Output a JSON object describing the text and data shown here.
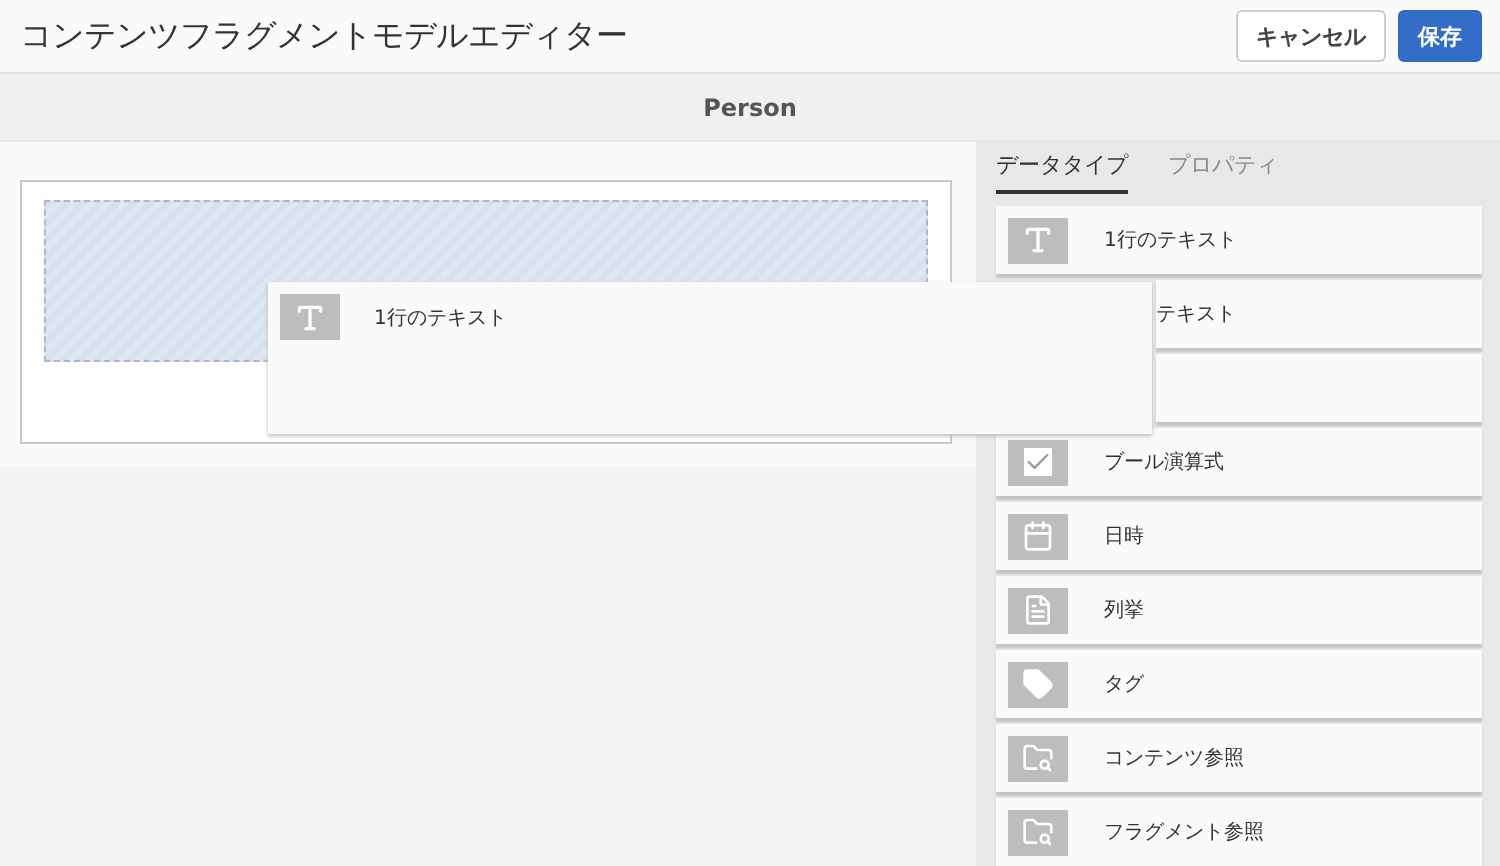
{
  "header": {
    "title": "コンテンツフラグメントモデルエディター",
    "buttons": [
      {
        "label": "キャンセル",
        "kind": "secondary"
      },
      {
        "label": "保存",
        "kind": "primary"
      }
    ]
  },
  "model_title": "Person",
  "dragged_item": {
    "label": "1行のテキスト"
  },
  "tabs": [
    {
      "label": "データタイプ",
      "selected": true
    },
    {
      "label": "プロパティ",
      "selected": false
    }
  ],
  "data_types": [
    {
      "kind": "text",
      "label": "1行のテキスト"
    },
    {
      "kind": "partial",
      "label": "テキスト"
    },
    {
      "kind": "covered"
    },
    {
      "kind": "check",
      "label": "ブール演算式"
    },
    {
      "kind": "calendar",
      "label": "日時"
    },
    {
      "kind": "list",
      "label": "列挙"
    },
    {
      "kind": "tag",
      "label": "タグ"
    },
    {
      "kind": "folder",
      "label": "コンテンツ参照"
    },
    {
      "kind": "folder",
      "label": "フラグメント参照"
    }
  ]
}
